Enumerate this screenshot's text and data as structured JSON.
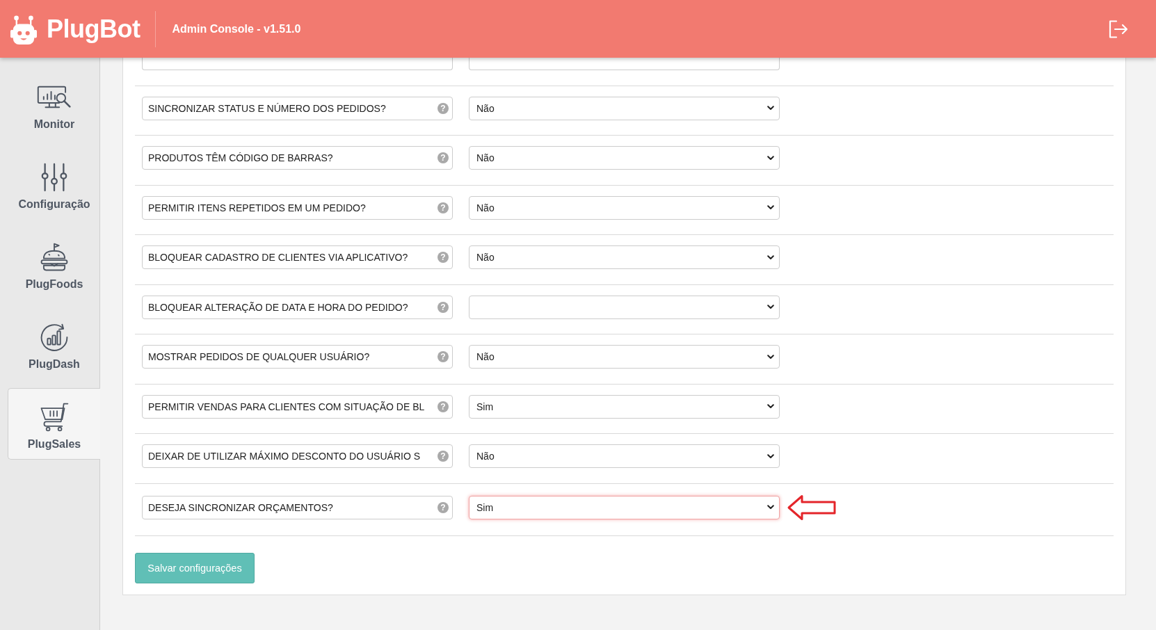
{
  "header": {
    "logo": "PlugBot",
    "title": "Admin Console - v1.51.0"
  },
  "sidebar": {
    "items": [
      {
        "label": "Monitor",
        "selected": false
      },
      {
        "label": "Configuração",
        "selected": false
      },
      {
        "label": "PlugFoods",
        "selected": false
      },
      {
        "label": "PlugDash",
        "selected": false
      },
      {
        "label": "PlugSales",
        "selected": true
      }
    ]
  },
  "settings": [
    {
      "label": "SINCRONIZAR STATUS E NÚMERO DOS PEDIDOS?",
      "help": "?",
      "value": "Não",
      "focused": false,
      "pointed": false
    },
    {
      "label": "PRODUTOS TÊM CÓDIGO DE BARRAS?",
      "help": "?",
      "value": "Não",
      "focused": false,
      "pointed": false
    },
    {
      "label": "PERMITIR ITENS REPETIDOS EM UM PEDIDO?",
      "help": "?",
      "value": "Não",
      "focused": false,
      "pointed": false
    },
    {
      "label": "BLOQUEAR CADASTRO DE CLIENTES VIA APLICATIVO?",
      "help": "?",
      "value": "Não",
      "focused": false,
      "pointed": false
    },
    {
      "label": "BLOQUEAR ALTERAÇÃO DE DATA E HORA DO PEDIDO?",
      "help": "?",
      "focused": false,
      "pointed": false
    },
    {
      "label": "MOSTRAR PEDIDOS DE QUALQUER USUÁRIO?",
      "help": "?",
      "value": "Não",
      "focused": false,
      "pointed": false
    },
    {
      "label": "PERMITIR VENDAS PARA CLIENTES COM SITUAÇÃO DE BL",
      "help": "?",
      "value": "Sim",
      "focused": false,
      "pointed": false
    },
    {
      "label": "DEIXAR DE UTILIZAR MÁXIMO DESCONTO DO USUÁRIO S",
      "help": "?",
      "value": "Não",
      "focused": false,
      "pointed": false
    },
    {
      "label": "DESEJA SINCRONIZAR ORÇAMENTOS?",
      "help": "?",
      "value": "Sim",
      "focused": true,
      "pointed": true
    }
  ],
  "save_button": "Salvar configurações"
}
